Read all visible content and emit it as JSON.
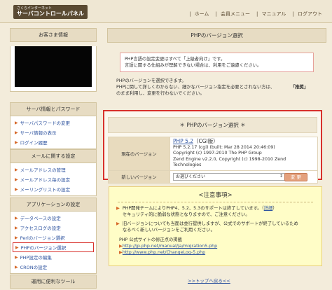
{
  "header": {
    "brand_sub": "さくらインターネット",
    "brand_main": "サーバコントロールパネル",
    "nav": [
      "ホーム",
      "会員メニュー",
      "マニュアル",
      "ログアウト"
    ]
  },
  "sidebar": {
    "guest_title": "お客さま情報",
    "sections": [
      {
        "title": "サーバ情報とパスワード",
        "items": [
          "サーバパスワードの変更",
          "サーバ情報の表示",
          "ログイン履歴"
        ]
      },
      {
        "title": "メールに関する設定",
        "items": [
          "メールアドレスの管理",
          "メールアドレス毎の設定",
          "メーリングリストの設定"
        ]
      },
      {
        "title": "アプリケーションの設定",
        "items": [
          "データベースの設定",
          "アクセスログの設定",
          "Perlのバージョン選択",
          "PHPのバージョン選択",
          "PHP設定の編集",
          "CRONの設定"
        ]
      },
      {
        "title": "運用に便利なツール",
        "items": []
      }
    ]
  },
  "main": {
    "title": "PHPのバージョン選択",
    "warning_line1": "PHP言語の設定変更はすべて「上級者向け」です。",
    "warning_line2": "言語に関する仕組みが理解できない場合は、利用をご遠慮ください。",
    "desc_line1": "PHPのバージョンを選択できます。",
    "desc_line2": "PHPに関して詳しくわからない、細かなバージョン指定を必要とされない方は、",
    "desc_recommend": "「推奨」",
    "desc_line3": "のまま利用し、変更を行わないでください。",
    "selector": {
      "title": "＊ PHPのバージョン選択 ＊",
      "current_label": "現在のバージョン",
      "current_version": "PHP 5.2",
      "current_cgi": "（CGI版）",
      "build_lines": [
        "PHP 5.2.17 (cgi) (built: Mar 28 2014 20:46:09)",
        "Copyright (c) 1997-2010 The PHP Group",
        "Zend Engine v2.2.0, Copyright (c) 1998-2010 Zend Technologies"
      ],
      "new_label": "新しいバージョン",
      "select_placeholder": "お選びください",
      "change_button": "変 更"
    },
    "notice": {
      "title": "<注意事項>",
      "item1_text": "PHP開発チームによりPHP4、5.2、5.3のサポートは終了しています。（",
      "item1_link": "詳細",
      "item1_end": "）",
      "item1_line2": "セキュリティ的に脆弱な状態となりますので、ご注意ください。",
      "item2_line1": "旧バージョンについても当面は並行提供しますが、公式でのサポートが終了しているため",
      "item2_line2": "なるべく新しいバージョンをご利用ください。",
      "site_title": "PHP 公式サイトの修正点の掲載",
      "link1": "http://jp.php.net/manual/ja/migration5.php",
      "link2": "http://www.php.net/ChangeLog-5.php"
    },
    "top_link": ">>トップへ戻る<<"
  }
}
